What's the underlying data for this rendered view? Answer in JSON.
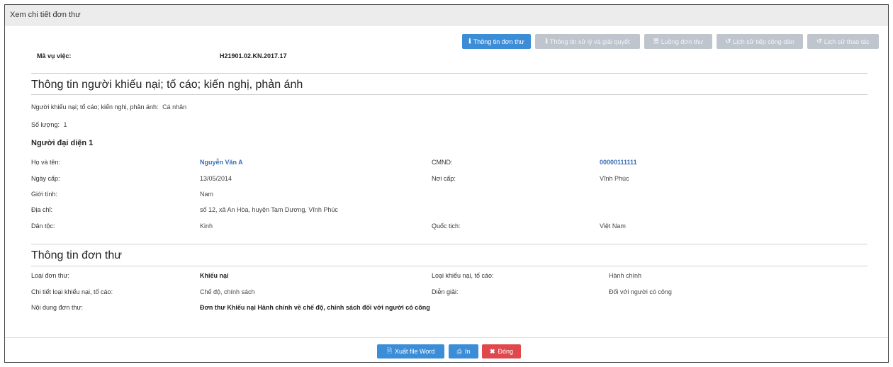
{
  "window": {
    "title": "Xem chi tiết đơn thư"
  },
  "tabs": [
    {
      "label": "Thông tin đơn thư",
      "icon": "info-icon"
    },
    {
      "label": "Thông tin xử lý và giải quyết",
      "icon": "info-icon"
    },
    {
      "label": "Luồng đơn thư",
      "icon": "list-icon"
    },
    {
      "label": "Lịch sử tiếp công dân",
      "icon": "history-icon"
    },
    {
      "label": "Lịch sử thao tác",
      "icon": "history-icon"
    }
  ],
  "case": {
    "label": "Mã vụ việc:",
    "value": "H21901.02.KN.2017.17"
  },
  "complainant_section": {
    "title": "Thông tin người khiếu nại; tố cáo; kiến nghị, phản ánh",
    "type_label": "Người khiếu nại; tố cáo; kiến nghị, phản ánh:",
    "type_value": "Cá nhân",
    "count_label": "Số lượng:",
    "count_value": "1",
    "rep_title": "Người đại diện 1",
    "name_label": "Họ và tên:",
    "name_value": "Nguyễn Văn A",
    "id_label": "CMND:",
    "id_value": "00000111111",
    "issue_date_label": "Ngày cấp:",
    "issue_date_value": "13/05/2014",
    "issue_place_label": "Nơi cấp:",
    "issue_place_value": "Vĩnh Phúc",
    "gender_label": "Giới tính:",
    "gender_value": "Nam",
    "address_label": "Địa chỉ:",
    "address_value": "số 12, xã An Hòa, huyện Tam Dương, Vĩnh Phúc",
    "ethnic_label": "Dân tộc:",
    "ethnic_value": "Kinh",
    "nationality_label": "Quốc tịch:",
    "nationality_value": "Việt Nam"
  },
  "petition_section": {
    "title": "Thông tin đơn thư",
    "type_label": "Loại đơn thư:",
    "type_value": "Khiếu nại",
    "kind_label": "Loại khiếu nại, tố cáo:",
    "kind_value": "Hành chính",
    "detail_label": "Chi tiết loại khiếu nại, tố cáo:",
    "detail_value": "Chế độ, chính sách",
    "explain_label": "Diễn giải:",
    "explain_value": "Đối với người có công",
    "content_label": "Nội dung đơn thư:",
    "content_value": "Đơn thư Khiếu nại Hành chính về chế độ, chính sách đối với người có công"
  },
  "footer": {
    "export_label": "Xuất file Word",
    "print_label": "In",
    "close_label": "Đóng"
  },
  "colors": {
    "primary": "#3c8dd8",
    "danger": "#e0484e",
    "disabled": "#bfc5cd",
    "link": "#3a6fb4"
  }
}
